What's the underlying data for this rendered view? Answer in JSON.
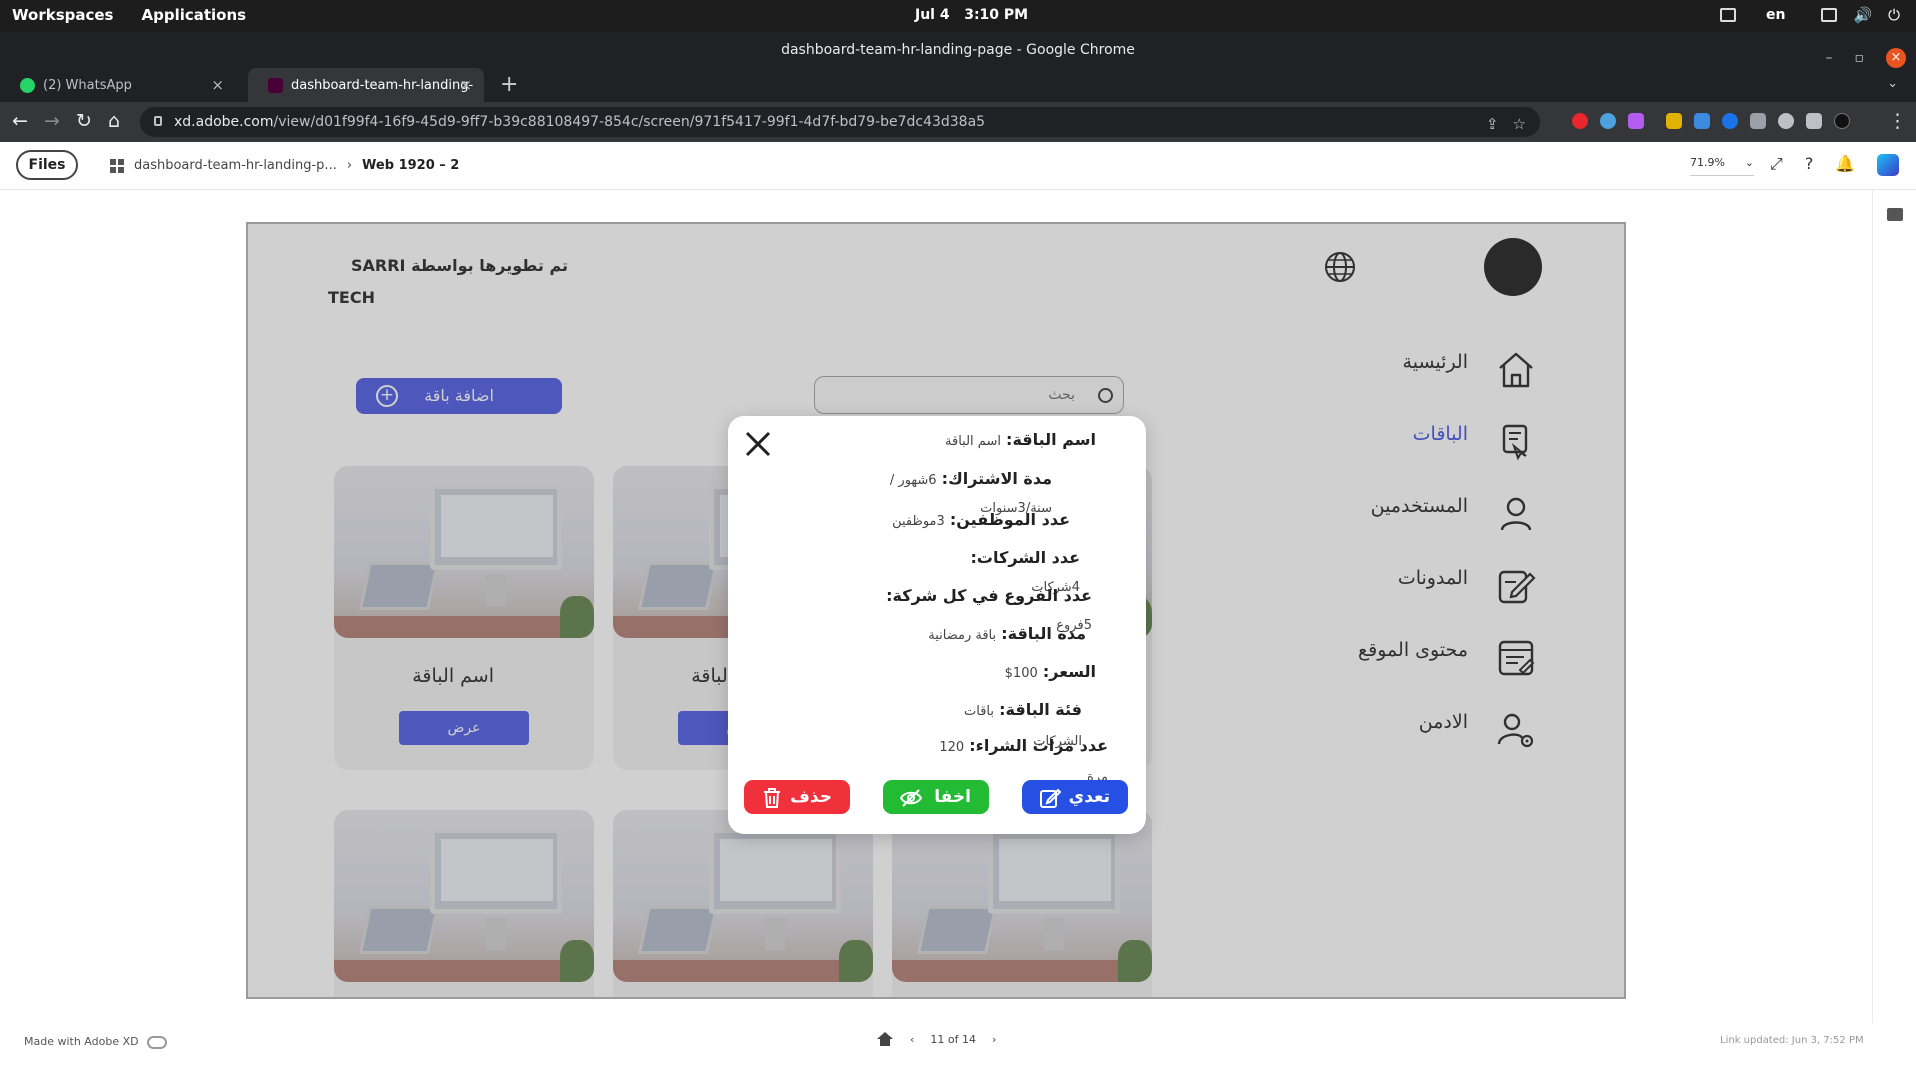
{
  "os": {
    "workspaces": "Workspaces",
    "applications": "Applications",
    "date": "Jul 4",
    "time": "3:10 PM",
    "lang": "en"
  },
  "chrome": {
    "window_title": "dashboard-team-hr-landing-page - Google Chrome",
    "tabs": [
      {
        "label": "(2) WhatsApp",
        "favicon_color": "#25d366"
      },
      {
        "label": "dashboard-team-hr-landing-",
        "favicon_color": "#470137"
      }
    ],
    "url_host": "xd.adobe.com",
    "url_path": "/view/d01f99f4-16f9-45d9-9ff7-b39c88108497-854c/screen/971f5417-99f1-4d7f-bd79-be7dc43d38a5"
  },
  "xd": {
    "files_label": "Files",
    "breadcrumb_project": "dashboard-team-hr-landing-p...",
    "breadcrumb_screen": "Web 1920 – 2",
    "zoom": "71.9%",
    "made_with": "Made with Adobe XD",
    "page_indicator": "11 of 14",
    "link_updated": "Link updated: Jun 3, 7:52 PM"
  },
  "app": {
    "brand_line1": "تم تطويرها بواسطة SARRI",
    "brand_line2": "TECH",
    "sidebar": [
      {
        "label": "الرئيسية",
        "icon": "home-icon",
        "active": false
      },
      {
        "label": "الباقات",
        "icon": "package-icon",
        "active": true
      },
      {
        "label": "المستخدمين",
        "icon": "user-icon",
        "active": false
      },
      {
        "label": "المدونات",
        "icon": "edit-note-icon",
        "active": false
      },
      {
        "label": "محتوى الموقع",
        "icon": "content-icon",
        "active": false
      },
      {
        "label": "الادمن",
        "icon": "admin-icon",
        "active": false
      }
    ],
    "add_button": "اضافة باقة",
    "search_placeholder": "بحث",
    "cards": [
      {
        "name": "اسم الباقة",
        "view": "عرض"
      },
      {
        "name": "اسم الباقة",
        "view": "عرض"
      },
      {
        "name": "",
        "view": ""
      },
      {
        "name": "",
        "view": ""
      },
      {
        "name": "",
        "view": ""
      },
      {
        "name": "",
        "view": ""
      }
    ],
    "accent": "#5865e6"
  },
  "modal": {
    "rows": [
      {
        "key": "اسم الباقة:",
        "value": "اسم الباقة"
      },
      {
        "key": "مدة الاشتراك:",
        "value": "6شهور / سنة/3سنوات"
      },
      {
        "key": "عدد الموظفين:",
        "value": "3موظفين"
      },
      {
        "key": "عدد الشركات:",
        "value": "4شركات"
      },
      {
        "key": "عدد الفروع في كل شركة:",
        "value": "5فروع"
      },
      {
        "key": "مدة الباقة:",
        "value": "باقة رمضانية"
      },
      {
        "key": "السعر:",
        "value": "100$"
      },
      {
        "key": "فئة الباقة:",
        "value": "باقات الشركات"
      },
      {
        "key": "عدد مرات الشراء:",
        "value": "120 مرة"
      }
    ],
    "edit": "تعدي",
    "hide": "اخفا",
    "delete": "حذف",
    "colors": {
      "edit": "#2650e4",
      "hide": "#22bb33",
      "delete": "#f0303a"
    }
  }
}
